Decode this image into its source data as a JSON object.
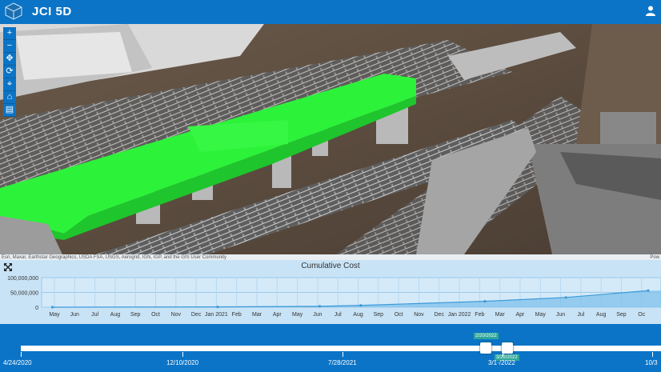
{
  "header": {
    "title": "JCI 5D"
  },
  "toolbar": {
    "tools": [
      "+",
      "−",
      "✥",
      "⟳",
      "⌖",
      "⌂",
      "▤"
    ]
  },
  "scene": {
    "attribution": "Esri, Maxar, Earthstar Geographics, USDA FSA, USGS, Aerogrid, IGN, IGP, and the GIS User Community",
    "powered_by": "Pow"
  },
  "chart": {
    "title": "Cumulative Cost"
  },
  "chart_data": {
    "type": "area",
    "title": "Cumulative Cost",
    "xlabel": "",
    "ylabel": "",
    "ylim": [
      0,
      100000000
    ],
    "yticks": [
      "100,000,000",
      "50,000,000",
      "0"
    ],
    "xticks": [
      "May",
      "Jun",
      "Jul",
      "Aug",
      "Sep",
      "Oct",
      "Nov",
      "Dec",
      "Jan 2021",
      "Feb",
      "Mar",
      "Apr",
      "May",
      "Jun",
      "Jul",
      "Aug",
      "Sep",
      "Oct",
      "Nov",
      "Dec",
      "Jan 2022",
      "Feb",
      "Mar",
      "Apr",
      "May",
      "Jun",
      "Jul",
      "Aug",
      "Sep",
      "Oc"
    ],
    "x": [
      "2020-05-01",
      "2021-01-01",
      "2021-06-01",
      "2021-08-01",
      "2022-02-01",
      "2022-06-01",
      "2022-10-01"
    ],
    "y": [
      0,
      1000000,
      3000000,
      6000000,
      20000000,
      33000000,
      56000000
    ],
    "series_color": "#7fc0ea"
  },
  "timeline": {
    "labels": [
      "4/24/2020",
      "12/10/2020",
      "7/28/2021",
      "3/1·/2022",
      "10/3"
    ],
    "handle_start_label": "2/20/2022",
    "handle_end_label": "3/22/2022"
  }
}
